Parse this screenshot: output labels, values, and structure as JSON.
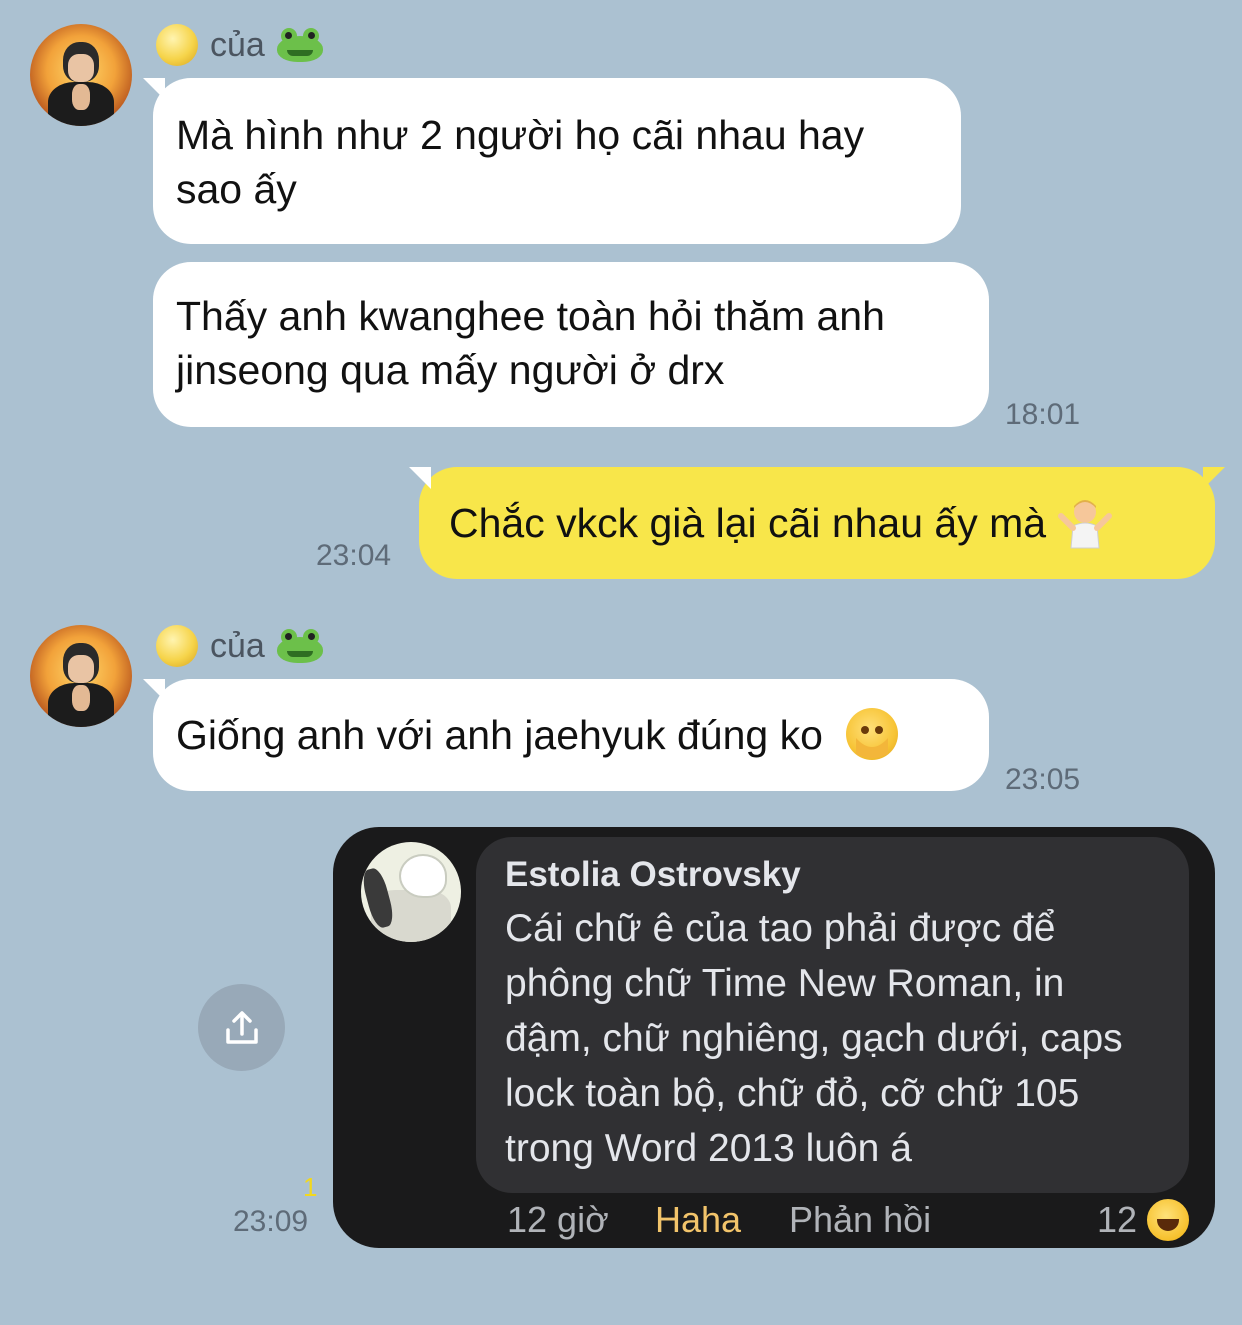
{
  "chat": {
    "group1": {
      "sender_label": "của",
      "messages": [
        {
          "text_line1": "Mà hình như 2 người họ cãi nhau hay",
          "text_line2": "sao ấy"
        },
        {
          "text_line1": "Thấy anh kwanghee toàn hỏi thăm anh",
          "text_line2": "jinseong qua mấy người ở drx"
        }
      ],
      "time": "18:01"
    },
    "my_message": {
      "text": "Chắc vkck già lại cãi nhau ấy mà",
      "emoji_icon": "person-shrugging-icon",
      "time": "23:04"
    },
    "group2": {
      "sender_label": "của",
      "text": "Giống anh với anh jaehyuk đúng ko",
      "emoji_icon": "face-with-open-eyes-and-hand-over-mouth-icon",
      "time": "23:05"
    },
    "shared_image": {
      "unread_count": "1",
      "time": "23:09",
      "comment": {
        "author": "Estolia Ostrovsky",
        "lines": [
          "Cái chữ ê của tao phải được để",
          "phông chữ Time New Roman, in",
          "đậm, chữ nghiêng, gạch dưới, caps",
          "lock toàn bộ, chữ đỏ, cỡ chữ 105",
          "trong Word 2013 luôn á"
        ],
        "age": "12 giờ",
        "reaction_label": "Haha",
        "reply_label": "Phản hồi",
        "reaction_count": "12"
      }
    }
  },
  "icons": {
    "share": "share-icon",
    "sender_prefix": "moon-emoji-icon",
    "sender_suffix": "frog-emoji-icon"
  },
  "colors": {
    "background": "#abc1d1",
    "incoming_bubble": "#ffffff",
    "outgoing_bubble": "#f8e64a",
    "unread": "#f2d81e"
  }
}
